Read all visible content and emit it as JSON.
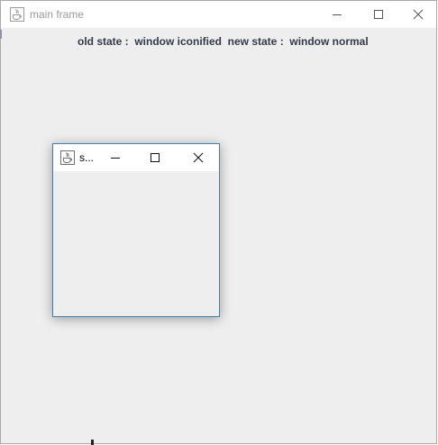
{
  "main_window": {
    "title": "main frame",
    "icon": "java-cup-icon",
    "controls": {
      "minimize": "minimize-icon",
      "maximize": "maximize-icon",
      "close": "close-icon"
    },
    "state_label": "old state :  window iconified  new state :  window normal"
  },
  "sub_window": {
    "title": "s...",
    "icon": "java-cup-icon",
    "controls": {
      "minimize": "minimize-icon",
      "maximize": "maximize-icon",
      "close": "close-icon"
    }
  },
  "colors": {
    "window_background": "#eeeeee",
    "titlebar_background": "#ffffff",
    "active_border": "#3c7fb1",
    "label_text": "#333b4a"
  }
}
